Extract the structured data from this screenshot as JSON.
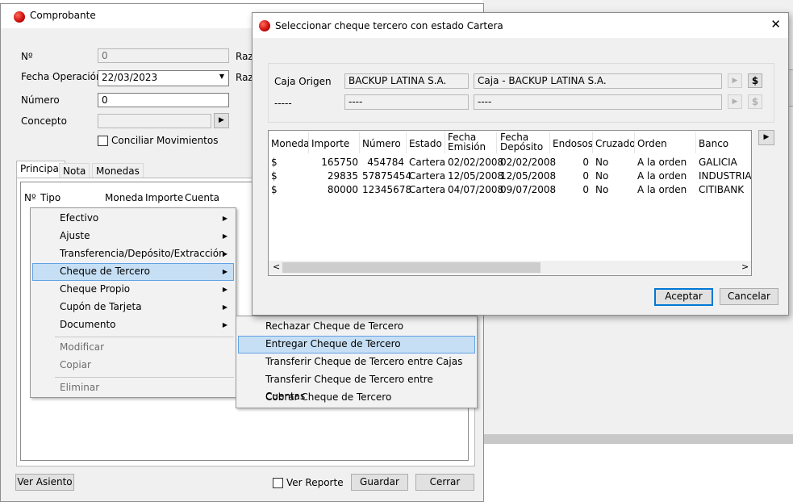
{
  "bg_window": {},
  "comprobante": {
    "title": "Comprobante",
    "fields": {
      "nro_label": "Nº",
      "nro_value": "0",
      "fecha_label": "Fecha Operación",
      "fecha_value": "22/03/2023",
      "numero_label": "Número",
      "numero_value": "0",
      "concepto_label": "Concepto",
      "concepto_value": "",
      "conciliar_label": "Conciliar Movimientos",
      "raz1": "Raz",
      "raz2": "Raz"
    },
    "tabs": [
      "Principal",
      "Nota",
      "Monedas"
    ],
    "grid_columns": [
      "Nº",
      "Tipo",
      "Moneda",
      "Importe",
      "Cuenta"
    ],
    "buttons": {
      "ver_asiento": "Ver Asiento",
      "ver_reporte": "Ver Reporte",
      "guardar": "Guardar",
      "cerrar": "Cerrar"
    }
  },
  "context_menu": {
    "items": [
      {
        "label": "Efectivo",
        "submenu": true
      },
      {
        "label": "Ajuste",
        "submenu": true
      },
      {
        "label": "Transferencia/Depósito/Extracción",
        "submenu": true
      },
      {
        "label": "Cheque de Tercero",
        "submenu": true,
        "selected": true
      },
      {
        "label": "Cheque Propio",
        "submenu": true
      },
      {
        "label": "Cupón de Tarjeta",
        "submenu": true
      },
      {
        "label": "Documento",
        "submenu": true
      },
      {
        "label": "Modificar",
        "disabled": true
      },
      {
        "label": "Copiar",
        "disabled": true
      },
      {
        "label": "Eliminar",
        "disabled": true
      }
    ]
  },
  "submenu": {
    "items": [
      {
        "label": "Rechazar Cheque de Tercero"
      },
      {
        "label": "Entregar Cheque de Tercero",
        "selected": true
      },
      {
        "label": "Transferir Cheque de Tercero entre Cajas"
      },
      {
        "label": "Transferir Cheque de Tercero entre Cuentas"
      },
      {
        "label": "Cobrar Cheque de Tercero"
      }
    ]
  },
  "dialog": {
    "title": "Seleccionar cheque tercero con estado Cartera",
    "close_glyph": "✕",
    "caja_origen_label": "Caja Origen",
    "caja_code": "BACKUP LATINA S.A.",
    "caja_desc": "Caja - BACKUP LATINA S.A.",
    "row2_label": "-----",
    "row2_code": "----",
    "row2_desc": "----",
    "dollar": "$",
    "columns": [
      "Moneda",
      "Importe",
      "Número",
      "Estado",
      "Fecha Emisión",
      "Fecha Depósito",
      "Endosos",
      "Cruzado",
      "Orden",
      "Banco"
    ],
    "rows": [
      [
        "$",
        "165750",
        "454784",
        "Cartera",
        "02/02/2008",
        "02/02/2008",
        "0",
        "No",
        "A la orden",
        "GALICIA"
      ],
      [
        "$",
        "29835",
        "57875454",
        "Cartera",
        "12/05/2008",
        "12/05/2008",
        "0",
        "No",
        "A la orden",
        "INDUSTRIAL"
      ],
      [
        "$",
        "80000",
        "12345678",
        "Cartera",
        "04/07/2008",
        "09/07/2008",
        "0",
        "No",
        "A la orden",
        "CITIBANK"
      ]
    ],
    "aceptar": "Aceptar",
    "cancelar": "Cancelar"
  }
}
